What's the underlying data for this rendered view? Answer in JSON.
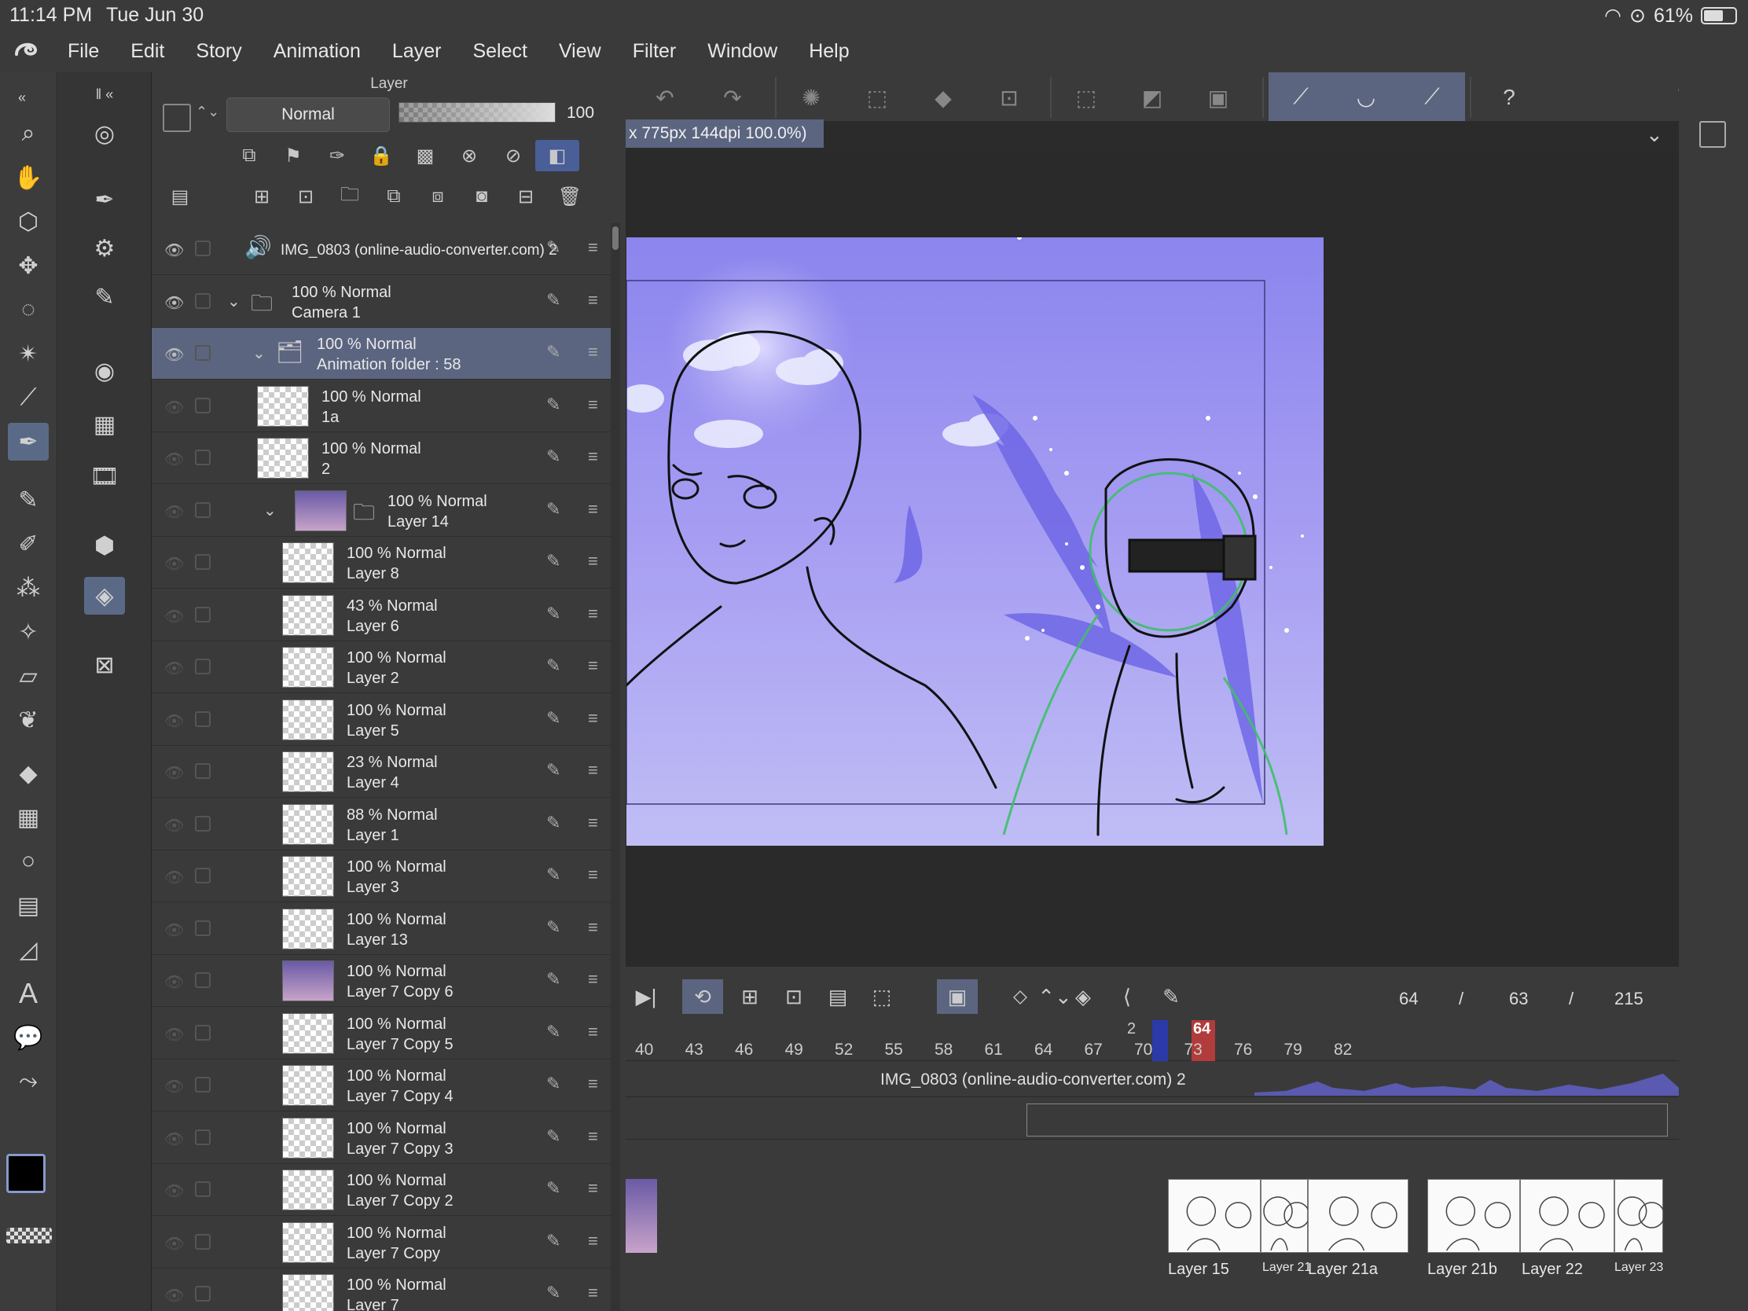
{
  "status_bar": {
    "time": "11:14 PM",
    "date": "Tue Jun 30",
    "battery": "61%"
  },
  "menu": {
    "items": [
      "File",
      "Edit",
      "Story",
      "Animation",
      "Layer",
      "Select",
      "View",
      "Filter",
      "Window",
      "Help"
    ]
  },
  "layer_panel": {
    "title": "Layer",
    "blend_mode": "Normal",
    "opacity": "100",
    "layers": [
      {
        "opacity": "",
        "name": "IMG_0803 (online-audio-converter.com) 2",
        "kind": "audio",
        "visible": true,
        "indent": 0
      },
      {
        "opacity": "100 % Normal",
        "name": "Camera 1",
        "kind": "folder",
        "visible": true,
        "indent": 0
      },
      {
        "opacity": "100 % Normal",
        "name": "Animation folder : 58",
        "kind": "anim-folder",
        "visible": true,
        "indent": 1,
        "selected": true
      },
      {
        "opacity": "100 % Normal",
        "name": "1a",
        "kind": "layer",
        "visible": false,
        "indent": 2
      },
      {
        "opacity": "100 % Normal",
        "name": "2",
        "kind": "layer",
        "visible": false,
        "indent": 2
      },
      {
        "opacity": "100 % Normal",
        "name": "Layer 14",
        "kind": "folder-img",
        "visible": false,
        "indent": 2
      },
      {
        "opacity": "100 % Normal",
        "name": "Layer 8",
        "kind": "layer",
        "visible": false,
        "indent": 3
      },
      {
        "opacity": "43 % Normal",
        "name": "Layer 6",
        "kind": "layer",
        "visible": false,
        "indent": 3
      },
      {
        "opacity": "100 % Normal",
        "name": "Layer 2",
        "kind": "layer",
        "visible": false,
        "indent": 3
      },
      {
        "opacity": "100 % Normal",
        "name": "Layer 5",
        "kind": "layer",
        "visible": false,
        "indent": 3
      },
      {
        "opacity": "23 % Normal",
        "name": "Layer 4",
        "kind": "layer",
        "visible": false,
        "indent": 3
      },
      {
        "opacity": "88 % Normal",
        "name": "Layer 1",
        "kind": "layer",
        "visible": false,
        "indent": 3
      },
      {
        "opacity": "100 % Normal",
        "name": "Layer 3",
        "kind": "layer",
        "visible": false,
        "indent": 3
      },
      {
        "opacity": "100 % Normal",
        "name": "Layer 13",
        "kind": "layer",
        "visible": false,
        "indent": 3
      },
      {
        "opacity": "100 % Normal",
        "name": "Layer 7 Copy 6",
        "kind": "layer-img",
        "visible": false,
        "indent": 3
      },
      {
        "opacity": "100 % Normal",
        "name": "Layer 7 Copy 5",
        "kind": "layer",
        "visible": false,
        "indent": 3
      },
      {
        "opacity": "100 % Normal",
        "name": "Layer 7 Copy 4",
        "kind": "layer",
        "visible": false,
        "indent": 3
      },
      {
        "opacity": "100 % Normal",
        "name": "Layer 7 Copy 3",
        "kind": "layer",
        "visible": false,
        "indent": 3
      },
      {
        "opacity": "100 % Normal",
        "name": "Layer 7 Copy 2",
        "kind": "layer",
        "visible": false,
        "indent": 3
      },
      {
        "opacity": "100 % Normal",
        "name": "Layer 7 Copy",
        "kind": "layer",
        "visible": false,
        "indent": 3
      },
      {
        "opacity": "100 % Normal",
        "name": "Layer 7",
        "kind": "layer",
        "visible": false,
        "indent": 3
      }
    ]
  },
  "canvas": {
    "tab_label": "x 775px 144dpi 100.0%)"
  },
  "timeline": {
    "current_frame": "64",
    "end_frame": "63",
    "total_frames": "215",
    "separator": "/",
    "playhead_label": "64",
    "marker_label": "2",
    "ticks": [
      "40",
      "43",
      "46",
      "49",
      "52",
      "55",
      "58",
      "61",
      "64",
      "67",
      "70",
      "73",
      "76",
      "79",
      "82"
    ],
    "audio_track": "IMG_0803 (online-audio-converter.com) 2",
    "cells": [
      "Layer 15",
      "Layer 21",
      "Layer 21a",
      "Layer 21b",
      "Layer 22",
      "Layer 23"
    ]
  },
  "colors": {
    "selection": "#5b6580",
    "playhead": "#b23b3b",
    "canvas_top": "#8b85ee",
    "canvas_bottom": "#c0bdf5"
  }
}
